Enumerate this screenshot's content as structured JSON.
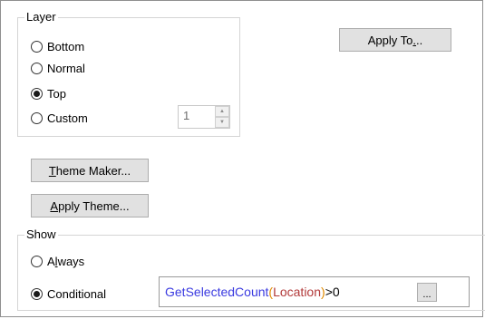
{
  "layer": {
    "title": "Layer",
    "options": [
      {
        "label": "Bottom",
        "checked": false
      },
      {
        "label": "Normal",
        "checked": false
      },
      {
        "label": "Top",
        "checked": true
      },
      {
        "label": "Custom",
        "checked": false
      }
    ],
    "custom_value": "1"
  },
  "buttons": {
    "apply_to_pre": "Apply To",
    "apply_to_mnemonic": ".",
    "apply_to_post": "..",
    "theme_maker_mnemonic": "T",
    "theme_maker_rest": "heme Maker...",
    "apply_theme_mnemonic": "A",
    "apply_theme_rest": "pply Theme..."
  },
  "show": {
    "title": "Show",
    "always_pre": "A",
    "always_mnemonic": "l",
    "always_post": "ways",
    "always_checked": false,
    "conditional_label": "Conditional",
    "conditional_checked": true,
    "expression": {
      "function": "GetSelectedCount",
      "open_paren": "(",
      "argument": "Location",
      "close_paren": ")",
      "operator": ">0"
    },
    "expr_button": "..."
  }
}
